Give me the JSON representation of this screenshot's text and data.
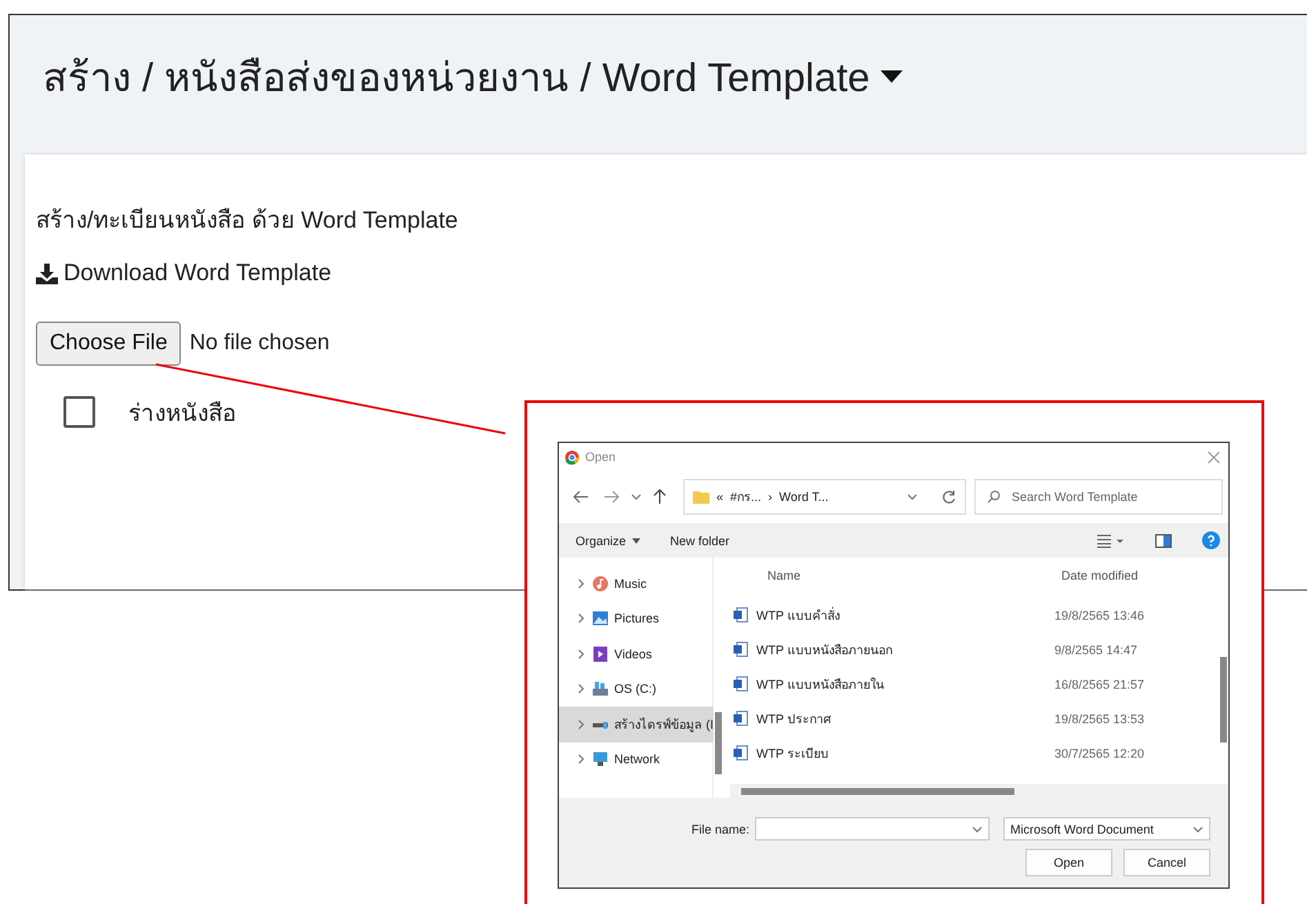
{
  "header": {
    "title": "สร้าง / หนังสือส่งของหน่วยงาน / Word Template"
  },
  "form": {
    "heading": "สร้าง/ทะเบียนหนังสือ ด้วย Word Template",
    "download_link": "Download Word Template",
    "file_button": "Choose File",
    "file_status": "No file chosen",
    "checkbox": {
      "label": "ร่างหนังสือ",
      "checked": false
    }
  },
  "dialog": {
    "title": "Open",
    "address_parts": [
      "«",
      "#กร...",
      "›",
      "Word T..."
    ],
    "search_placeholder": "Search Word Template",
    "toolbar": [
      "Organize",
      "New folder"
    ],
    "nav_items": [
      {
        "label": "Music",
        "kind": "music",
        "selected": false
      },
      {
        "label": "Pictures",
        "kind": "pictures",
        "selected": false
      },
      {
        "label": "Videos",
        "kind": "videos",
        "selected": false
      },
      {
        "label": "OS (C:)",
        "kind": "disk",
        "selected": false
      },
      {
        "label": "สร้างไดรฟ์ข้อมูล (I",
        "kind": "drive",
        "selected": true
      },
      {
        "label": "Network",
        "kind": "network",
        "selected": false
      }
    ],
    "columns": [
      "Name",
      "Date modified"
    ],
    "files": [
      {
        "name": "WTP แบบคำสั่ง",
        "date": "19/8/2565 13:46"
      },
      {
        "name": "WTP แบบหนังสือภายนอก",
        "date": "9/8/2565 14:47"
      },
      {
        "name": "WTP แบบหนังสือภายใน",
        "date": "16/8/2565 21:57"
      },
      {
        "name": "WTP ประกาศ",
        "date": "19/8/2565 13:53"
      },
      {
        "name": "WTP ระเบียบ",
        "date": "30/7/2565 12:20"
      }
    ],
    "file_name_label": "File name:",
    "file_type": "Microsoft Word Document",
    "buttons": [
      "Open",
      "Cancel"
    ]
  }
}
